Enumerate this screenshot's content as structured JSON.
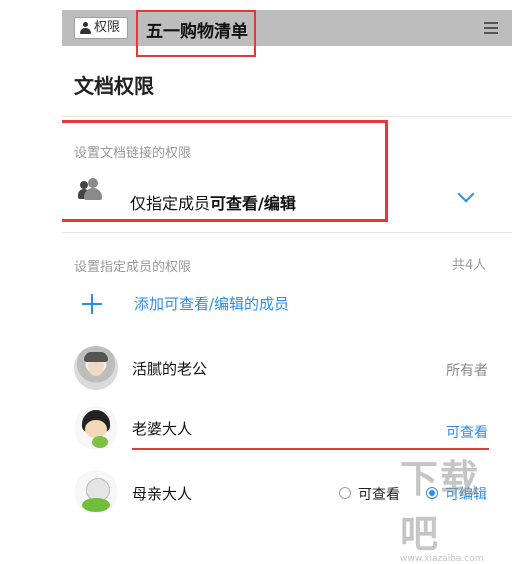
{
  "topbar": {
    "permission_button_label": "权限",
    "doc_title": "五一购物清单"
  },
  "page_title": "文档权限",
  "link_section": {
    "label": "设置文档链接的权限",
    "prefix": "仅指定成员",
    "mode": "可查看/编辑"
  },
  "members_section": {
    "label": "设置指定成员的权限",
    "count": "共4人",
    "add_label": "添加可查看/编辑的成员"
  },
  "members": [
    {
      "name": "活腻的老公",
      "role": "所有者"
    },
    {
      "name": "老婆大人",
      "role": "可查看"
    },
    {
      "name": "母亲大人",
      "options": [
        "可查看",
        "可编辑"
      ],
      "selected": "可编辑"
    }
  ],
  "watermark": {
    "text": "下载吧",
    "sub": "www.xiazaiba.com"
  },
  "colors": {
    "accent": "#2b8ee5",
    "highlight": "#e53935",
    "topbar": "#bdbdbd"
  }
}
